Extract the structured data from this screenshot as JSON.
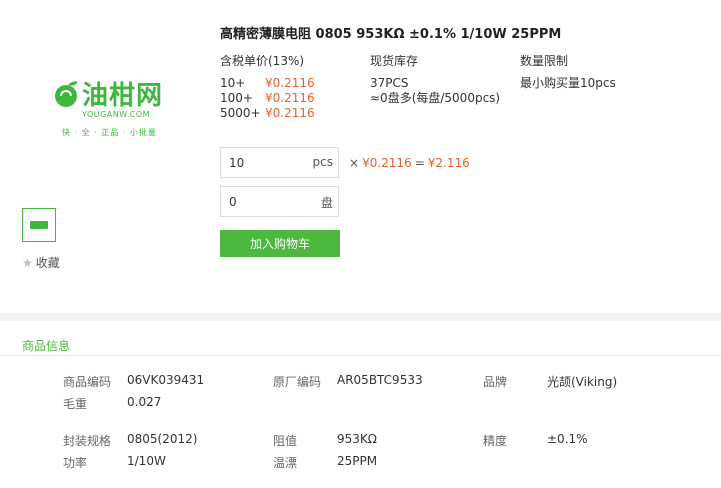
{
  "product": {
    "title": "高精密薄膜电阻 0805 953KΩ ±0.1% 1/10W 25PPM"
  },
  "pricing": {
    "header": "含税单价(13%)",
    "tiers": [
      {
        "qty": "10+",
        "price": "¥0.2116"
      },
      {
        "qty": "100+",
        "price": "¥0.2116"
      },
      {
        "qty": "5000+",
        "price": "¥0.2116"
      }
    ]
  },
  "stock": {
    "header": "现货库存",
    "line1": "37PCS",
    "line2": "≈0盘多(每盘/5000pcs)"
  },
  "limit": {
    "header": "数量限制",
    "line1": "最小购买量10pcs"
  },
  "logo": {
    "text": "油柑网",
    "sub": "YOUGANW.COM",
    "slogan": "快 · 全 · 正品 · 小批量",
    "color": "#3fb73f"
  },
  "favorite": {
    "label": "收藏"
  },
  "order": {
    "pcs_value": "10",
    "pcs_unit": "pcs",
    "reel_value": "0",
    "reel_unit": "盘",
    "multiply": "×",
    "unit_price": "¥0.2116",
    "equals": "=",
    "total": "¥2.116",
    "add_to_cart": "加入购物车"
  },
  "info": {
    "section_title": "商品信息",
    "rows": [
      {
        "l1": "商品编码",
        "v1": "06VK039431",
        "l2": "原厂编码",
        "v2": "AR05BTC9533",
        "l3": "品牌",
        "v3": "光颉(Viking)"
      },
      {
        "l1": "毛重",
        "v1": "0.027"
      },
      {
        "l1": "封装规格",
        "v1": "0805(2012)",
        "l2": "阻值",
        "v2": "953KΩ",
        "l3": "精度",
        "v3": "±0.1%"
      },
      {
        "l1": "功率",
        "v1": "1/10W",
        "l2": "温漂",
        "v2": "25PPM"
      }
    ]
  },
  "colors": {
    "accent": "#4cb83e",
    "price": "#e8612c"
  }
}
